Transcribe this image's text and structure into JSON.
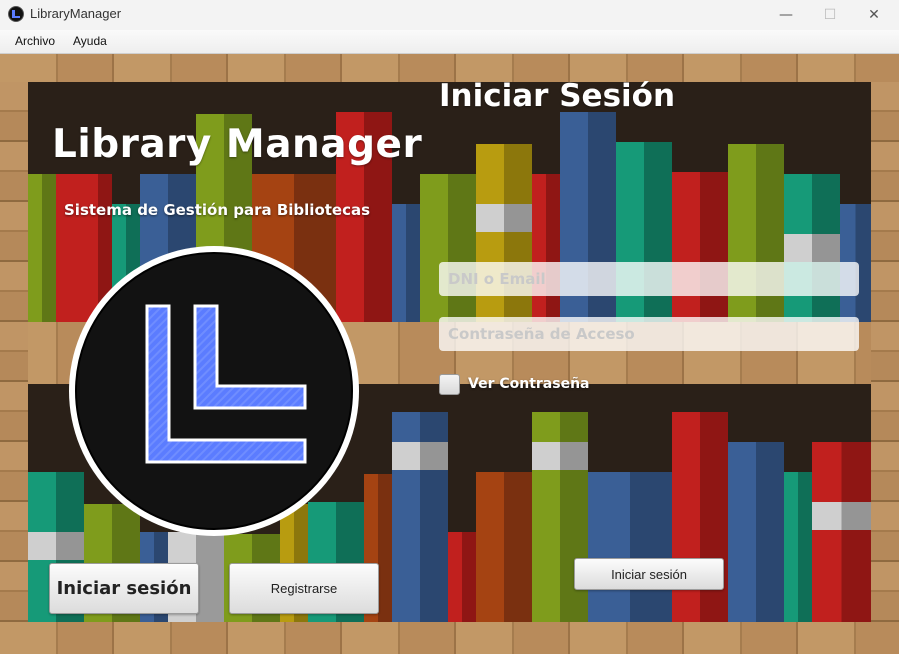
{
  "window": {
    "title": "LibraryManager",
    "minimize_glyph": "—",
    "maximize_glyph": "☐",
    "close_glyph": "✕",
    "app_icon": "library-manager-logo-icon"
  },
  "menubar": {
    "items": [
      {
        "label": "Archivo"
      },
      {
        "label": "Ayuda"
      }
    ]
  },
  "branding": {
    "title": "Library Manager",
    "subtitle": "Sistema de Gestión para Bibliotecas",
    "logo": "library-manager-logo-icon",
    "logo_color": "#5b7cff"
  },
  "login": {
    "heading": "Iniciar Sesión",
    "user_placeholder": "DNI o Email",
    "password_placeholder": "Contraseña de Acceso",
    "show_password_label": "Ver Contraseña",
    "show_password_checked": false,
    "submit_label": "Iniciar sesión"
  },
  "bottom_buttons": {
    "login_label": "Iniciar sesión",
    "register_label": "Registrarse"
  },
  "background": "bookshelf"
}
